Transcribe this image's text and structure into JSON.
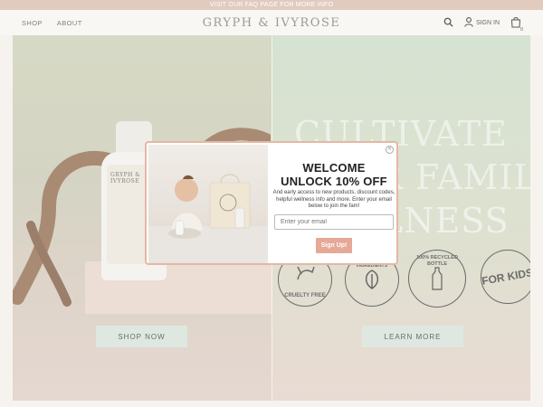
{
  "topbar": {
    "text": "VISIT OUR FAQ PAGE FOR MORE INFO"
  },
  "header": {
    "nav": [
      {
        "label": "SHOP"
      },
      {
        "label": "ABOUT"
      }
    ],
    "logo": "GRYPH & IVYROSE",
    "signin_label": "SIGN IN",
    "cart_count": "0"
  },
  "hero": {
    "left": {
      "bottle_label": "GRYPH & IVYROSE",
      "button": "SHOP NOW"
    },
    "right": {
      "title_lines": [
        "CULTIVATE",
        "YOUR FAMILY'S",
        "WELLNESS"
      ],
      "badges": [
        {
          "label": "CRUELTY FREE",
          "icon": "bunny-icon"
        },
        {
          "label": "PLANT BASED INGREDIENTS",
          "icon": "leaf-icon"
        },
        {
          "label": "100% RECYCLED BOTTLE",
          "icon": "bottle-icon"
        },
        {
          "label": "FOR KIDS",
          "icon": "text-badge"
        }
      ],
      "button": "LEARN MORE"
    }
  },
  "modal": {
    "title_line1": "WELCOME",
    "title_line2": "UNLOCK 10% OFF",
    "description": "And early access to new products, discount codes, helpful wellness info and more. Enter your email below to join the fam!",
    "email_placeholder": "Enter your email",
    "submit_label": "Sign Up!",
    "close_icon": "close-icon"
  },
  "colors": {
    "topbar": "#d9b9a8",
    "button_green": "#d3e0d6",
    "signup_button": "#e6a897",
    "modal_border": "#e4b8a4"
  }
}
